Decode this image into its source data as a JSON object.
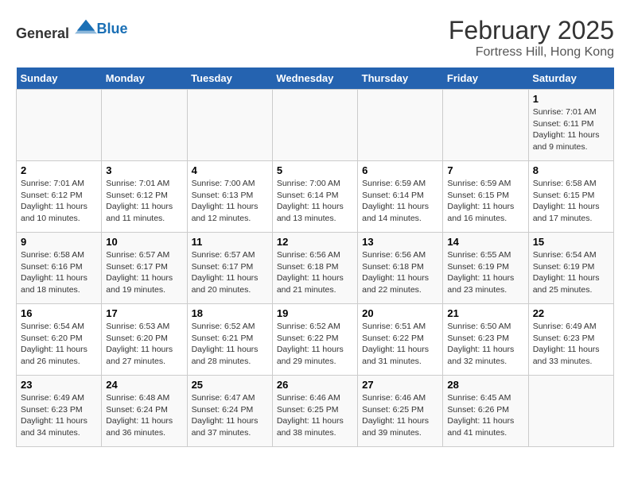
{
  "header": {
    "logo_general": "General",
    "logo_blue": "Blue",
    "month_title": "February 2025",
    "subtitle": "Fortress Hill, Hong Kong"
  },
  "days_of_week": [
    "Sunday",
    "Monday",
    "Tuesday",
    "Wednesday",
    "Thursday",
    "Friday",
    "Saturday"
  ],
  "weeks": [
    {
      "days": [
        {
          "num": "",
          "info": ""
        },
        {
          "num": "",
          "info": ""
        },
        {
          "num": "",
          "info": ""
        },
        {
          "num": "",
          "info": ""
        },
        {
          "num": "",
          "info": ""
        },
        {
          "num": "",
          "info": ""
        },
        {
          "num": "1",
          "info": "Sunrise: 7:01 AM\nSunset: 6:11 PM\nDaylight: 11 hours and 9 minutes."
        }
      ]
    },
    {
      "days": [
        {
          "num": "2",
          "info": "Sunrise: 7:01 AM\nSunset: 6:12 PM\nDaylight: 11 hours and 10 minutes."
        },
        {
          "num": "3",
          "info": "Sunrise: 7:01 AM\nSunset: 6:12 PM\nDaylight: 11 hours and 11 minutes."
        },
        {
          "num": "4",
          "info": "Sunrise: 7:00 AM\nSunset: 6:13 PM\nDaylight: 11 hours and 12 minutes."
        },
        {
          "num": "5",
          "info": "Sunrise: 7:00 AM\nSunset: 6:14 PM\nDaylight: 11 hours and 13 minutes."
        },
        {
          "num": "6",
          "info": "Sunrise: 6:59 AM\nSunset: 6:14 PM\nDaylight: 11 hours and 14 minutes."
        },
        {
          "num": "7",
          "info": "Sunrise: 6:59 AM\nSunset: 6:15 PM\nDaylight: 11 hours and 16 minutes."
        },
        {
          "num": "8",
          "info": "Sunrise: 6:58 AM\nSunset: 6:15 PM\nDaylight: 11 hours and 17 minutes."
        }
      ]
    },
    {
      "days": [
        {
          "num": "9",
          "info": "Sunrise: 6:58 AM\nSunset: 6:16 PM\nDaylight: 11 hours and 18 minutes."
        },
        {
          "num": "10",
          "info": "Sunrise: 6:57 AM\nSunset: 6:17 PM\nDaylight: 11 hours and 19 minutes."
        },
        {
          "num": "11",
          "info": "Sunrise: 6:57 AM\nSunset: 6:17 PM\nDaylight: 11 hours and 20 minutes."
        },
        {
          "num": "12",
          "info": "Sunrise: 6:56 AM\nSunset: 6:18 PM\nDaylight: 11 hours and 21 minutes."
        },
        {
          "num": "13",
          "info": "Sunrise: 6:56 AM\nSunset: 6:18 PM\nDaylight: 11 hours and 22 minutes."
        },
        {
          "num": "14",
          "info": "Sunrise: 6:55 AM\nSunset: 6:19 PM\nDaylight: 11 hours and 23 minutes."
        },
        {
          "num": "15",
          "info": "Sunrise: 6:54 AM\nSunset: 6:19 PM\nDaylight: 11 hours and 25 minutes."
        }
      ]
    },
    {
      "days": [
        {
          "num": "16",
          "info": "Sunrise: 6:54 AM\nSunset: 6:20 PM\nDaylight: 11 hours and 26 minutes."
        },
        {
          "num": "17",
          "info": "Sunrise: 6:53 AM\nSunset: 6:20 PM\nDaylight: 11 hours and 27 minutes."
        },
        {
          "num": "18",
          "info": "Sunrise: 6:52 AM\nSunset: 6:21 PM\nDaylight: 11 hours and 28 minutes."
        },
        {
          "num": "19",
          "info": "Sunrise: 6:52 AM\nSunset: 6:22 PM\nDaylight: 11 hours and 29 minutes."
        },
        {
          "num": "20",
          "info": "Sunrise: 6:51 AM\nSunset: 6:22 PM\nDaylight: 11 hours and 31 minutes."
        },
        {
          "num": "21",
          "info": "Sunrise: 6:50 AM\nSunset: 6:23 PM\nDaylight: 11 hours and 32 minutes."
        },
        {
          "num": "22",
          "info": "Sunrise: 6:49 AM\nSunset: 6:23 PM\nDaylight: 11 hours and 33 minutes."
        }
      ]
    },
    {
      "days": [
        {
          "num": "23",
          "info": "Sunrise: 6:49 AM\nSunset: 6:23 PM\nDaylight: 11 hours and 34 minutes."
        },
        {
          "num": "24",
          "info": "Sunrise: 6:48 AM\nSunset: 6:24 PM\nDaylight: 11 hours and 36 minutes."
        },
        {
          "num": "25",
          "info": "Sunrise: 6:47 AM\nSunset: 6:24 PM\nDaylight: 11 hours and 37 minutes."
        },
        {
          "num": "26",
          "info": "Sunrise: 6:46 AM\nSunset: 6:25 PM\nDaylight: 11 hours and 38 minutes."
        },
        {
          "num": "27",
          "info": "Sunrise: 6:46 AM\nSunset: 6:25 PM\nDaylight: 11 hours and 39 minutes."
        },
        {
          "num": "28",
          "info": "Sunrise: 6:45 AM\nSunset: 6:26 PM\nDaylight: 11 hours and 41 minutes."
        },
        {
          "num": "",
          "info": ""
        }
      ]
    }
  ]
}
